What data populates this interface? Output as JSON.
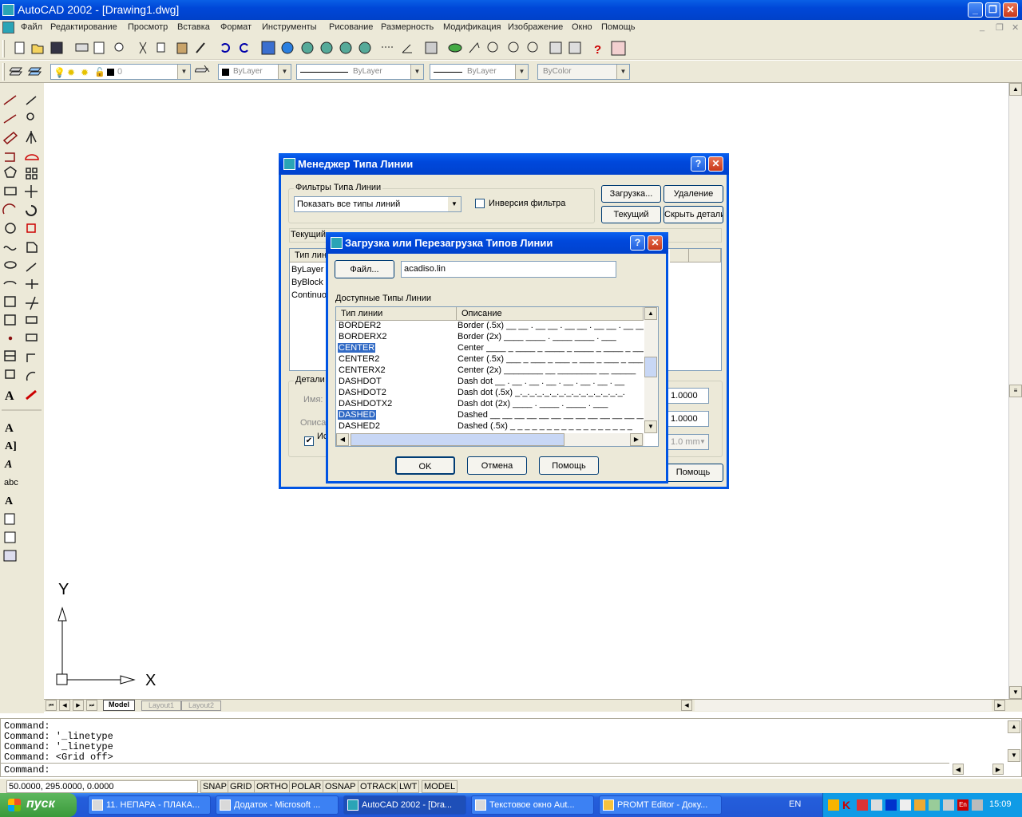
{
  "window": {
    "title": "AutoCAD 2002 - [Drawing1.dwg]"
  },
  "menubar": [
    "Файл",
    "Редактирование",
    "Просмотр",
    "Вставка",
    "Формат",
    "Инструменты",
    "Рисование",
    "Размерность",
    "Модификация",
    "Изображение",
    "Окно",
    "Помощь"
  ],
  "properties_bar": {
    "layer": "0",
    "color": "ByLayer",
    "linetype": "ByLayer",
    "lineweight": "ByLayer",
    "plotstyle": "ByColor"
  },
  "ucs": {
    "y_label": "Y",
    "x_label": "X"
  },
  "tabs": [
    "Model",
    "Layout1",
    "Layout2"
  ],
  "command_history": [
    "Command:",
    "Command:  '_linetype",
    "Command:  '_linetype",
    "Command:  <Grid off>"
  ],
  "command_prompt": "Command:",
  "status": {
    "coords": "50.0000, 295.0000, 0.0000",
    "toggles": [
      "SNAP",
      "GRID",
      "ORTHO",
      "POLAR",
      "OSNAP",
      "OTRACK",
      "LWT",
      "MODEL"
    ]
  },
  "taskbar": {
    "start": "пуск",
    "tasks": [
      "11. НЕПАРА - ПЛАКА...",
      "Додаток - Microsoft ...",
      "AutoCAD 2002 - [Dra...",
      "Текстовое окно Aut...",
      "PROMT Editor - Доку..."
    ],
    "lang": "EN",
    "clock": "15:09"
  },
  "ltmgr": {
    "title": "Менеджер Типа Линии",
    "filters_group": "Фильтры Типа Линии",
    "filter_value": "Показать все типы линий",
    "invert_label": "Инверсия фильтра",
    "load_btn": "Загрузка...",
    "delete_btn": "Удаление",
    "current_btn": "Текущий",
    "hide_details_btn": "Скрыть детали",
    "current_label": "Текущий",
    "list_header": "Тип линии",
    "list_rows": [
      "ByLayer",
      "ByBlock",
      "Continuous"
    ],
    "details_group": "Детали",
    "name_label": "Имя:",
    "desc_label": "Описание:",
    "use_paper_label": "Использовать единицы пространства бумаги",
    "scale1": "1.0000",
    "scale2": "1.0000",
    "pen_width": "1.0 mm",
    "help_btn": "Помощь"
  },
  "loaddlg": {
    "title": "Загрузка или Перезагрузка Типов Линии",
    "file_btn": "Файл...",
    "file_value": "acadiso.lin",
    "available_label": "Доступные Типы Линии",
    "col_type": "Тип линии",
    "col_desc": "Описание",
    "rows": [
      {
        "name": "BORDER2",
        "desc": "Border (.5x) __ __ . __ __ . __ __ . __ __ . __ __ ."
      },
      {
        "name": "BORDERX2",
        "desc": "Border (2x) ____  ____  .  ____  ____  .  ___"
      },
      {
        "name": "CENTER",
        "desc": "Center ____ _ ____ _ ____ _ ____ _ ____ _ ____"
      },
      {
        "name": "CENTER2",
        "desc": "Center (.5x) ___ _ ___ _ ___ _ ___ _ ___ _ ___"
      },
      {
        "name": "CENTERX2",
        "desc": "Center (2x) ________  __  ________  __  _____"
      },
      {
        "name": "DASHDOT",
        "desc": "Dash dot __ . __ . __ . __ . __ . __ . __ . __"
      },
      {
        "name": "DASHDOT2",
        "desc": "Dash dot (.5x) _._._._._._._._._._._._._._._."
      },
      {
        "name": "DASHDOTX2",
        "desc": "Dash dot (2x) ____  .  ____  .  ____  .  ___"
      },
      {
        "name": "DASHED",
        "desc": "Dashed __ __ __ __ __ __ __ __ __ __ __ __ __ _"
      },
      {
        "name": "DASHED2",
        "desc": "Dashed (.5x) _ _ _ _ _ _ _ _ _ _ _ _ _ _ _ _ _"
      }
    ],
    "ok_btn": "OK",
    "cancel_btn": "Отмена",
    "help_btn": "Помощь"
  }
}
